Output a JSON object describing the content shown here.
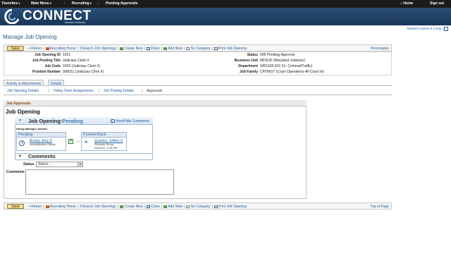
{
  "topnav": {
    "favorites": "Favorites",
    "main_menu": "Main Menu",
    "recruiting": "Recruiting",
    "pending_approvals": "Pending Approvals",
    "home": "Home",
    "sign_out": "Sign out",
    "sep": "›"
  },
  "brand": {
    "name": "CONNECT",
    "sub": "Maryland Judiciary"
  },
  "util": {
    "related_content": "Related Content",
    "help": "Help",
    "sep": "|"
  },
  "page": {
    "title": "Manage Job Opening"
  },
  "toolbar": {
    "save": "Save",
    "return": "Return",
    "recruiting_home": "Recruiting Home",
    "search_job_openings": "Search Job Openings",
    "create_new": "Create New",
    "clone": "Clone",
    "add_note": "Add Note",
    "no_category": "No Category",
    "print_job_opening": "Print Job Opening",
    "personalize": "Personalize",
    "top_of_page": "Top of Page",
    "sep": "|"
  },
  "info": {
    "job_opening_id_label": "Job Opening ID",
    "job_opening_id": "1021",
    "job_posting_title_label": "Job Posting Title",
    "job_posting_title": "Judiciary Clerk II",
    "job_code_label": "Job Code",
    "job_code": "2433 (Judiciary Clerk II)",
    "position_number_label": "Position Number",
    "position_number": "000011 (Judiciary Clerk II)",
    "status_label": "Status",
    "status": "006 Pending Approval",
    "business_unit_label": "Business Unit",
    "business_unit": "MDJUD (Maryland Judiciary)",
    "department_label": "Department",
    "department": "0451108 (DC 51- Criminal/Traffic)",
    "job_family_label": "Job Family",
    "job_family": "CRTMGT (Court Operations-All Court lvl)"
  },
  "tabs": [
    {
      "label": "Activity & Attachments"
    },
    {
      "label": "Details"
    }
  ],
  "subnav": {
    "job_opening_details": "Job Opening Details",
    "hiring_team_assignments": "Hiring Team Assignments",
    "job_posting_details": "Job Posting Details",
    "approvals": "Approvals",
    "sep": "|"
  },
  "approvals": {
    "header": "Job Approvals",
    "section_title": "Job Opening",
    "box_title": "Job Opening:",
    "box_status": "Pending",
    "view_hide_comments": "View/Hide Comments",
    "path_name": "Hiring Manager Submit",
    "stages": [
      {
        "head": "Pending",
        "name": "Bosley, Amy D",
        "role": "Administrative Official",
        "date": ""
      },
      {
        "head": "Pushed Back",
        "name": "Quasley, Jeffery S",
        "role": "Recruiter Group",
        "date": "09/09/15 - 2:36 PM"
      }
    ],
    "add_symbol": "+",
    "arrow_symbol": "→",
    "back_symbol": "◂",
    "comments_title": "Comments",
    "status_label": "Status",
    "status_value": "Select...",
    "comments_text_label": "Comments Text"
  }
}
